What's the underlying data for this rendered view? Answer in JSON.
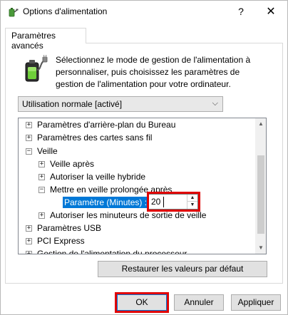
{
  "window": {
    "title": "Options d'alimentation",
    "help_glyph": "?",
    "close_glyph": "✕"
  },
  "tab": {
    "label": "Paramètres avancés"
  },
  "intro": {
    "text": "Sélectionnez le mode de gestion de l'alimentation à personnaliser, puis choisissez les paramètres de gestion de l'alimentation pour votre ordinateur."
  },
  "plan_select": {
    "selected": "Utilisation normale [activé]",
    "arrow_glyph": "⌵"
  },
  "tree": {
    "rows": [
      {
        "expander": "+",
        "label": "Paramètres d'arrière-plan du Bureau"
      },
      {
        "expander": "+",
        "label": "Paramètres des cartes sans fil"
      },
      {
        "expander": "−",
        "label": "Veille"
      },
      {
        "expander": "+",
        "label": "Veille après"
      },
      {
        "expander": "+",
        "label": "Autoriser la veille hybride"
      },
      {
        "expander": "−",
        "label": "Mettre en veille prolongée après"
      },
      {
        "expander": "",
        "label": "Paramètre (Minutes) :"
      },
      {
        "expander": "+",
        "label": "Autoriser les minuteurs de sortie de veille"
      },
      {
        "expander": "+",
        "label": "Paramètres USB"
      },
      {
        "expander": "+",
        "label": "PCI Express"
      },
      {
        "expander": "+",
        "label": "Gestion de l'alimentation du processeur"
      }
    ],
    "setting_value": "20",
    "spin_up_glyph": "▲",
    "spin_down_glyph": "▼",
    "scroll_up_glyph": "▲",
    "scroll_down_glyph": "▼"
  },
  "buttons": {
    "restore": "Restaurer les valeurs par défaut",
    "ok": "OK",
    "cancel": "Annuler",
    "apply": "Appliquer"
  }
}
